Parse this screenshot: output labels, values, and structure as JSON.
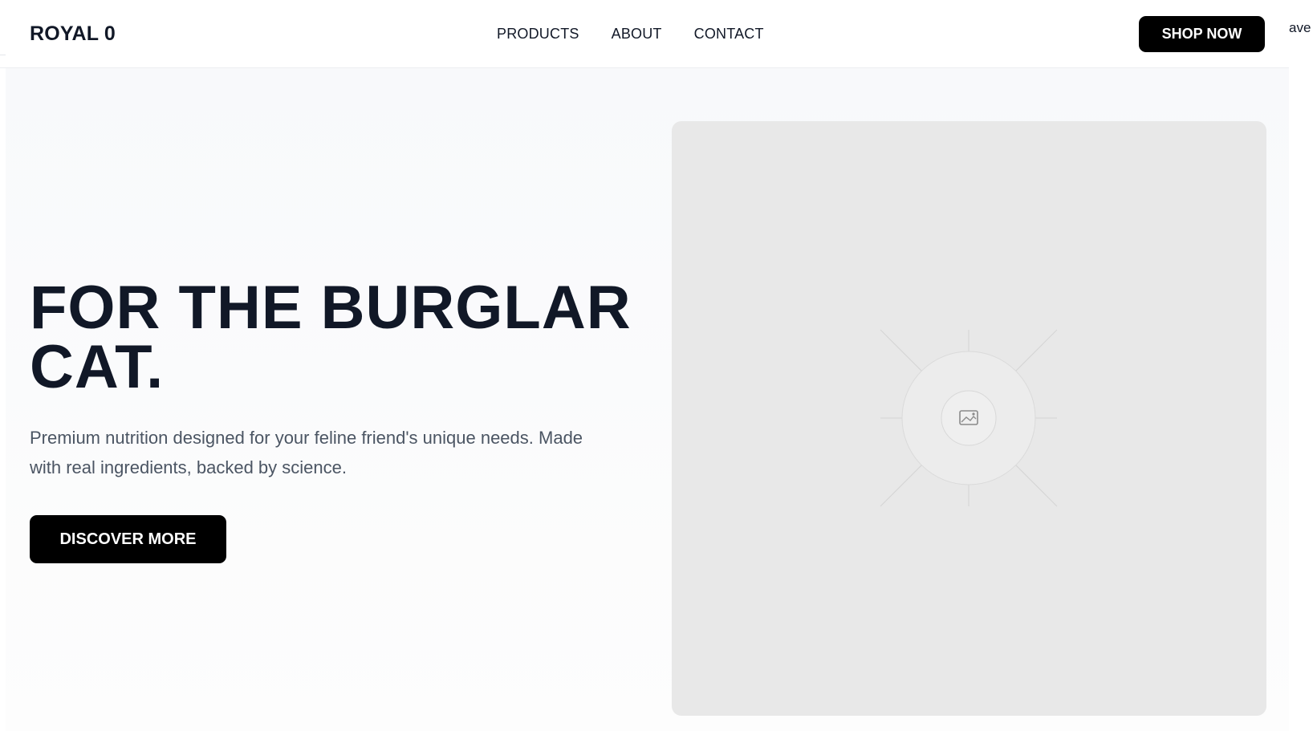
{
  "header": {
    "logo": "ROYAL 0",
    "nav": [
      {
        "label": "PRODUCTS"
      },
      {
        "label": "ABOUT"
      },
      {
        "label": "CONTACT"
      }
    ],
    "shop_button": "SHOP NOW",
    "overflow_text": "ave"
  },
  "hero": {
    "title": "FOR THE BURGLAR CAT.",
    "subtitle": "Premium nutrition designed for your feline friend's unique needs. Made with real ingredients, backed by science.",
    "cta": "DISCOVER MORE",
    "image": {
      "icon": "image-placeholder-icon"
    }
  },
  "colors": {
    "text_dark": "#111827",
    "text_muted": "#4b5563",
    "button_bg": "#000000",
    "button_text": "#ffffff",
    "hero_bg": "#f8f9fb",
    "placeholder_bg": "#e8e8e8"
  }
}
